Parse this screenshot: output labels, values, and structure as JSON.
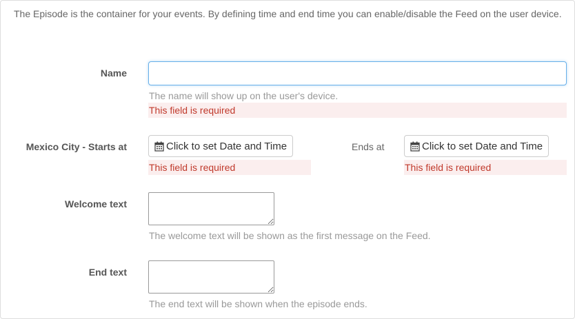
{
  "intro": "The Episode is the container for your events. By defining time and end time you can enable/disable the Feed on the user device.",
  "name_field": {
    "label": "Name",
    "value": "",
    "placeholder": "",
    "help": "The name will show up on the user's device.",
    "error": "This field is required"
  },
  "start_field": {
    "label": "Mexico City - Starts at",
    "button_label": "Click to set Date and Time",
    "error": "This field is required"
  },
  "end_field": {
    "label": "Ends at",
    "button_label": "Click to set Date and Time",
    "error": "This field is required"
  },
  "welcome_field": {
    "label": "Welcome text",
    "value": "",
    "help": "The welcome text will be shown as the first message on the Feed."
  },
  "end_text_field": {
    "label": "End text",
    "value": "",
    "help": "The end text will be shown when the episode ends."
  },
  "icons": {
    "calendar": "calendar-icon"
  },
  "colors": {
    "error_text": "#c0392b",
    "error_bg": "#fbeeee",
    "focus_border": "#66afe9"
  }
}
